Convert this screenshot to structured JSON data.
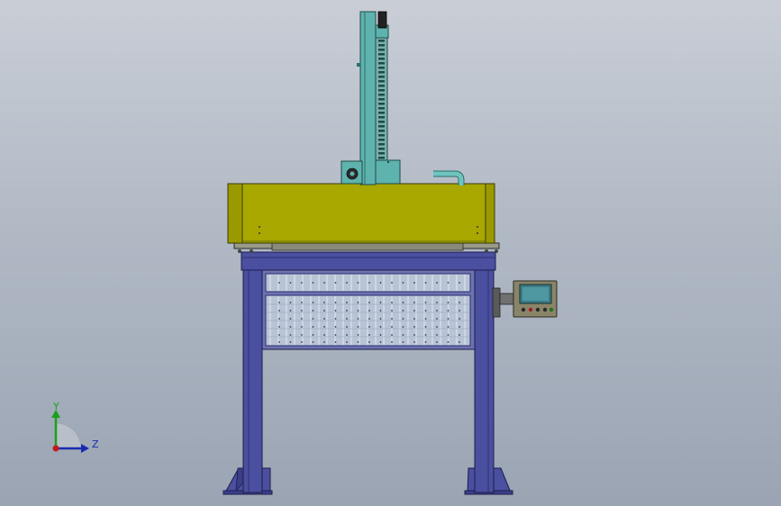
{
  "viewport": {
    "background_top": "#c9ced6",
    "background_bottom": "#9aa4b3"
  },
  "model": {
    "colors": {
      "frame": "#4a4fa0",
      "frame_dark": "#2d3070",
      "enclosure": "#a8a800",
      "enclosure_dark": "#6d6d00",
      "teal": "#5fb3ae",
      "teal_dark": "#2e6e6a",
      "screen": "#3a7c85",
      "panel": "#8a8468"
    }
  },
  "triad": {
    "y_label": "Y",
    "z_label": "Z",
    "y_color": "#1aa01a",
    "z_color": "#1a2ab0",
    "origin_color": "#c01a1a"
  }
}
